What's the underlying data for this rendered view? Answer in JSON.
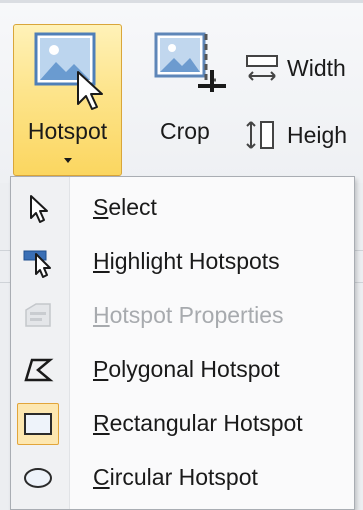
{
  "ribbon": {
    "hotspot_label": "Hotspot",
    "crop_label": "Crop",
    "width_label": "Width",
    "height_label": "Heigh"
  },
  "menu": {
    "items": [
      {
        "mnemonic": "S",
        "rest": "elect",
        "icon": "select-cursor-icon",
        "enabled": true,
        "checked": false
      },
      {
        "mnemonic": "H",
        "rest": "ighlight Hotspots",
        "icon": "highlight-hotspots-icon",
        "enabled": true,
        "checked": false
      },
      {
        "mnemonic": "H",
        "rest": "otspot Properties",
        "icon": "hotspot-properties-icon",
        "enabled": false,
        "checked": false
      },
      {
        "mnemonic": "P",
        "rest": "olygonal Hotspot",
        "icon": "polygon-icon",
        "enabled": true,
        "checked": false
      },
      {
        "mnemonic": "R",
        "rest": "ectangular Hotspot",
        "icon": "rectangle-icon",
        "enabled": true,
        "checked": true
      },
      {
        "mnemonic": "C",
        "rest": "ircular Hotspot",
        "icon": "ellipse-icon",
        "enabled": true,
        "checked": false
      }
    ]
  },
  "colors": {
    "active_button": "#fde48b",
    "active_border": "#d9a63a",
    "checked_item": "#fde7b0",
    "disabled_text": "#a7aaae"
  }
}
